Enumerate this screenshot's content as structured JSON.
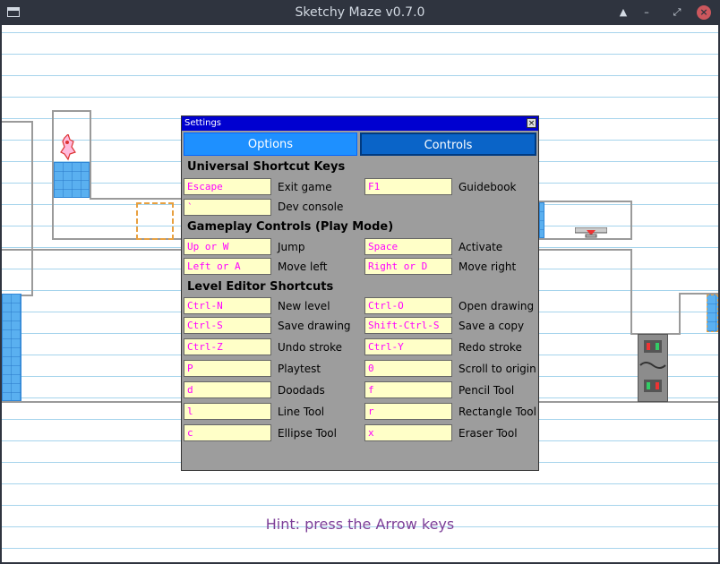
{
  "window": {
    "title": "Sketchy Maze v0.7.0",
    "controls": [
      "up-arrow-icon",
      "minimize-icon",
      "restore-icon",
      "close-icon"
    ]
  },
  "hint": "Hint: press the Arrow keys",
  "settings": {
    "title": "Settings",
    "close_label": "×",
    "tabs": {
      "options": "Options",
      "controls": "Controls"
    },
    "sections": {
      "universal": "Universal Shortcut Keys",
      "gameplay": "Gameplay Controls (Play Mode)",
      "editor": "Level Editor Shortcuts"
    },
    "shortcuts": [
      {
        "key": "Escape",
        "label": "Exit game"
      },
      {
        "key": "F1",
        "label": "Guidebook"
      },
      {
        "key": "`",
        "label": "Dev console"
      },
      {
        "key": "Up or W",
        "label": "Jump"
      },
      {
        "key": "Space",
        "label": "Activate"
      },
      {
        "key": "Left or A",
        "label": "Move left"
      },
      {
        "key": "Right or D",
        "label": "Move right"
      },
      {
        "key": "Ctrl-N",
        "label": "New level"
      },
      {
        "key": "Ctrl-O",
        "label": "Open drawing"
      },
      {
        "key": "Ctrl-S",
        "label": "Save drawing"
      },
      {
        "key": "Shift-Ctrl-S",
        "label": "Save a copy"
      },
      {
        "key": "Ctrl-Z",
        "label": "Undo stroke"
      },
      {
        "key": "Ctrl-Y",
        "label": "Redo stroke"
      },
      {
        "key": "P",
        "label": "Playtest"
      },
      {
        "key": "0",
        "label": "Scroll to origin"
      },
      {
        "key": "d",
        "label": "Doodads"
      },
      {
        "key": "f",
        "label": "Pencil Tool"
      },
      {
        "key": "l",
        "label": "Line Tool"
      },
      {
        "key": "r",
        "label": "Rectangle Tool"
      },
      {
        "key": "c",
        "label": "Ellipse Tool"
      },
      {
        "key": "x",
        "label": "Eraser Tool"
      }
    ]
  },
  "colors": {
    "titlebar": "#2f343f",
    "dialog_title": "#0000d0",
    "key_text": "#ff00ff",
    "key_bg": "#ffffc8",
    "hint": "#7d3f98",
    "tab_options": "#1e90ff"
  }
}
